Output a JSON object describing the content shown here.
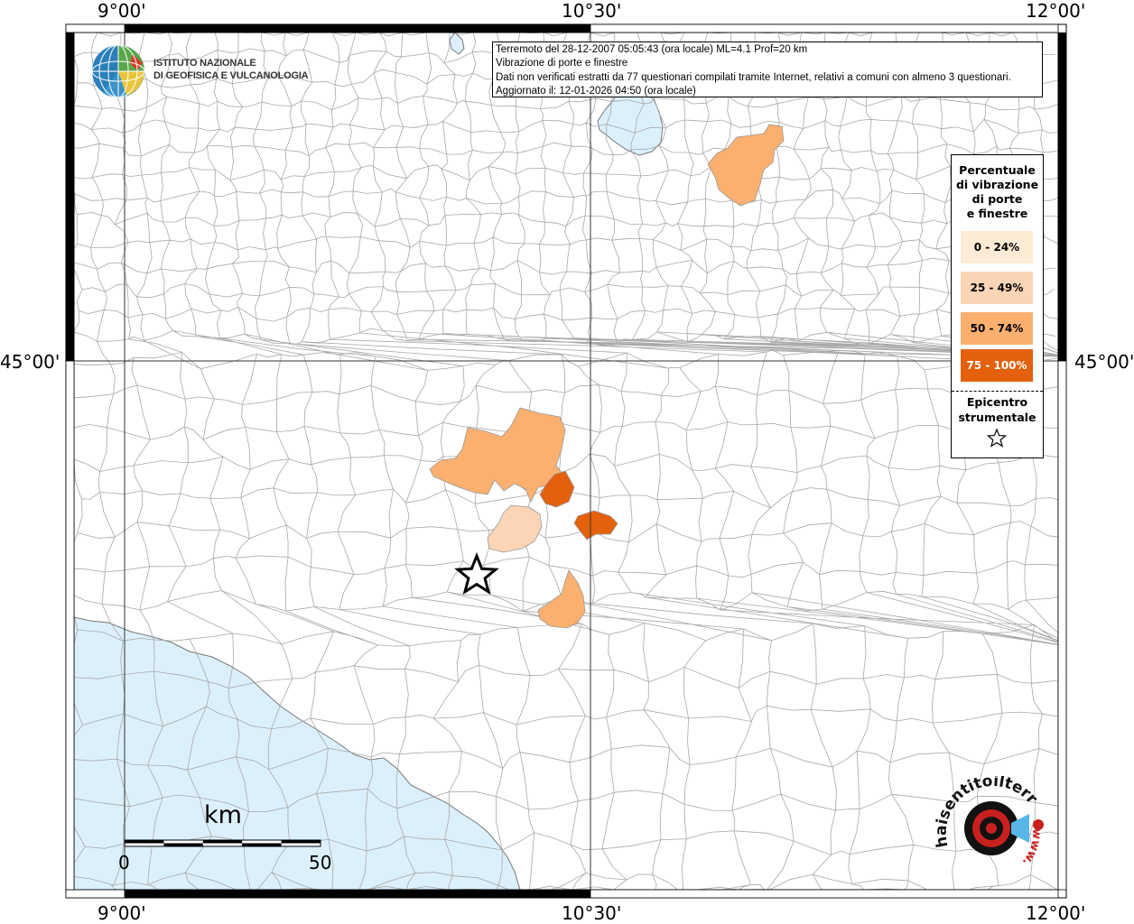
{
  "map": {
    "info": {
      "line1": "Terremoto del 28-12-2007 05:05:43 (ora locale) ML=4.1 Prof=20 km",
      "line2": "Vibrazione di porte e finestre",
      "line3": "Dati non verificati estratti da 77 questionari compilati tramite Internet, relativi a comuni con almeno 3 questionari.",
      "line4": "Aggiornato il: 12-01-2026 04:50 (ora locale)"
    },
    "axis_labels": {
      "top": [
        "9°00'",
        "10°30'",
        "12°00'"
      ],
      "bottom": [
        "9°00'",
        "10°30'",
        "12°00'"
      ],
      "left": "45°00'",
      "right": "45°00'"
    },
    "legend": {
      "title_lines": [
        "Percentuale",
        "di vibrazione",
        "di porte",
        "e finestre"
      ],
      "classes": [
        {
          "label": "0 - 24%",
          "color": "#fdebd6"
        },
        {
          "label": "25 - 49%",
          "color": "#fbd5b5"
        },
        {
          "label": "50 - 74%",
          "color": "#fbb06f"
        },
        {
          "label": "75 - 100%",
          "color": "#e4600c"
        }
      ],
      "epicenter_lines": [
        "Epicentro",
        "strumentale"
      ]
    },
    "scale": {
      "unit": "km",
      "start": "0",
      "end": "50"
    },
    "logos": {
      "ingv_line1": "ISTITUTO NAZIONALE",
      "ingv_line2": "DI GEOFISICA E VULCANOLOGIA",
      "hsit_text": "haisentitoilterremoto.it",
      "hsit_www": "www."
    },
    "colors": {
      "sea": "#dcf0fb",
      "border": "#9a9a9a",
      "grid": "#333333"
    }
  }
}
